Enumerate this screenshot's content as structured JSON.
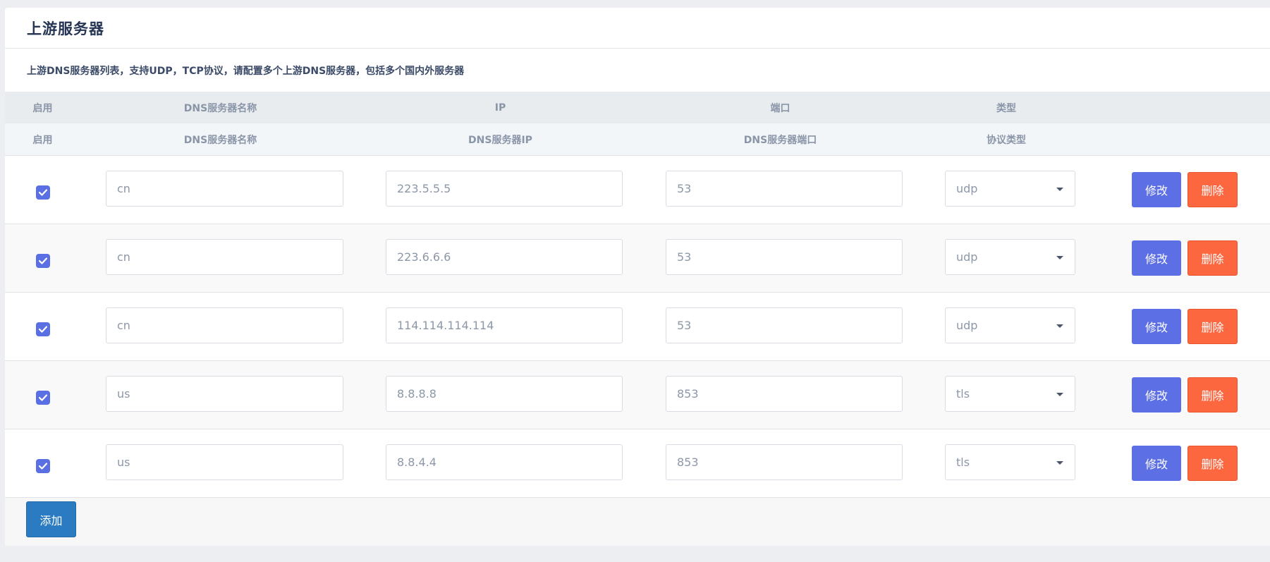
{
  "page": {
    "title": "上游服务器"
  },
  "description": "上游DNS服务器列表，支持UDP，TCP协议，请配置多个上游DNS服务器，包括多个国内外服务器",
  "table": {
    "header1": {
      "enabled": "启用",
      "name": "DNS服务器名称",
      "ip": "IP",
      "port": "端口",
      "type": "类型"
    },
    "header2": {
      "enabled": "启用",
      "name": "DNS服务器名称",
      "ip": "DNS服务器IP",
      "port": "DNS服务器端口",
      "type": "协议类型"
    },
    "rows": [
      {
        "enabled": true,
        "name": "cn",
        "ip": "223.5.5.5",
        "port": "53",
        "type": "udp"
      },
      {
        "enabled": true,
        "name": "cn",
        "ip": "223.6.6.6",
        "port": "53",
        "type": "udp"
      },
      {
        "enabled": true,
        "name": "cn",
        "ip": "114.114.114.114",
        "port": "53",
        "type": "udp"
      },
      {
        "enabled": true,
        "name": "us",
        "ip": "8.8.8.8",
        "port": "853",
        "type": "tls"
      },
      {
        "enabled": true,
        "name": "us",
        "ip": "8.8.4.4",
        "port": "853",
        "type": "tls"
      }
    ]
  },
  "actions": {
    "edit_label": "修改",
    "delete_label": "删除",
    "add_label": "添加"
  },
  "colors": {
    "primary": "#5d6fe4",
    "danger": "#fd6740",
    "add": "#2b7bc2"
  }
}
